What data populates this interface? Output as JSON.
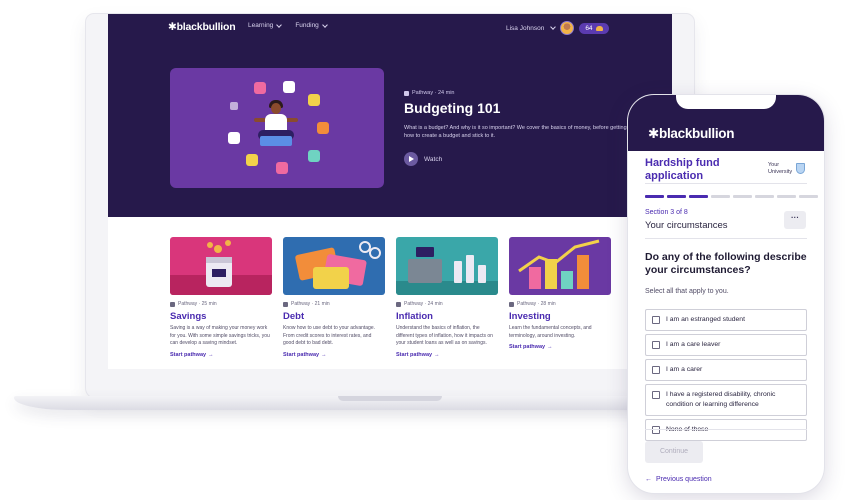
{
  "laptop": {
    "nav": {
      "logo": "✱blackbullion",
      "links": [
        "Learning",
        "Funding"
      ],
      "user_name": "Lisa Johnson",
      "points": "64"
    },
    "feature": {
      "meta": "Pathway · 24 min",
      "title": "Budgeting 101",
      "description": "What is a budget? And why is it so important? We cover the basics of money, before getting into how to create a budget and stick to it.",
      "watch_label": "Watch"
    },
    "cards": [
      {
        "meta": "Pathway · 25 min",
        "title": "Savings",
        "description": "Saving is a way of making your money work for you. With some simple savings tricks, you can develop a saving mindset.",
        "link": "Start pathway",
        "color": "#d9367b"
      },
      {
        "meta": "Pathway · 21 min",
        "title": "Debt",
        "description": "Know how to use debt to your advantage. From credit scores to interest rates, and good debt to bad debt.",
        "link": "Start pathway",
        "color": "#2f6db0"
      },
      {
        "meta": "Pathway · 24 min",
        "title": "Inflation",
        "description": "Understand the basics of inflation, the different types of inflation, how it impacts on your student loans as well as on savings.",
        "link": "Start pathway",
        "color": "#3aa7a9"
      },
      {
        "meta": "Pathway · 28 min",
        "title": "Investing",
        "description": "Learn the fundamental concepts, and terminology, around investing.",
        "link": "Start pathway",
        "color": "#6a39a3"
      }
    ]
  },
  "phone": {
    "logo": "✱blackbullion",
    "form_title": "Hardship fund application",
    "university_line1": "Your",
    "university_line2": "University",
    "progress": {
      "total": 8,
      "completed": 3
    },
    "section_label": "Section 3 of 8",
    "section_name": "Your circumstances",
    "more_label": "···",
    "question": "Do any of the following describe your circumstances?",
    "hint": "Select all that apply to you.",
    "options": [
      "I am an estranged student",
      "I am a care leaver",
      "I am a carer",
      "I have a registered disability, chronic condition or learning difference",
      "None of these"
    ],
    "continue_label": "Continue",
    "previous_label": "Previous question"
  },
  "colors": {
    "brand_dark": "#26194b",
    "brand_purple": "#4a2bb0"
  }
}
